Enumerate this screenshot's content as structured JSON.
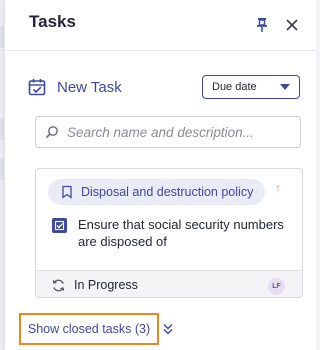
{
  "header": {
    "title": "Tasks",
    "pin_icon": "pin-icon",
    "close_icon": "close-icon"
  },
  "toolbar": {
    "new_task_label": "New Task",
    "new_task_icon": "calendar-check-icon",
    "sort_value": "Due date"
  },
  "search": {
    "placeholder": "Search name and description...",
    "value": ""
  },
  "task": {
    "policy_label": "Disposal and destruction policy",
    "priority_symbol": "↑",
    "description": "Ensure that social security numbers are disposed of",
    "checked": true,
    "status": "In Progress",
    "assignee_initials": "LF"
  },
  "footer": {
    "show_closed_label": "Show closed tasks (3)"
  },
  "colors": {
    "accent": "#3d4a9c",
    "priority": "#f0a020",
    "highlight_border": "#e58a1f",
    "tag_bg": "#e9ebf7"
  }
}
